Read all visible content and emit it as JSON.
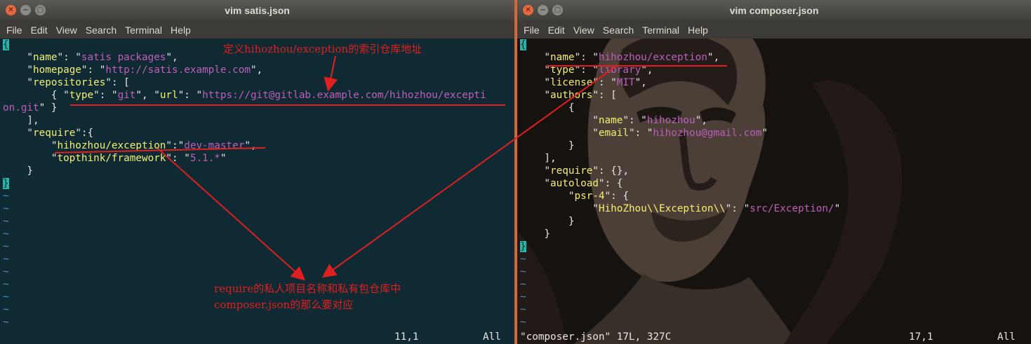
{
  "left_window": {
    "title": "vim satis.json",
    "menu": [
      "File",
      "Edit",
      "View",
      "Search",
      "Terminal",
      "Help"
    ],
    "lines": [
      [
        [
          "cur",
          "{"
        ]
      ],
      [
        [
          "p",
          "    \""
        ],
        [
          "k",
          "name"
        ],
        [
          "p",
          "\": \""
        ],
        [
          "s",
          "satis packages"
        ],
        [
          "p",
          "\","
        ]
      ],
      [
        [
          "p",
          "    \""
        ],
        [
          "k",
          "homepage"
        ],
        [
          "p",
          "\": \""
        ],
        [
          "s",
          "http://satis.example.com"
        ],
        [
          "p",
          "\","
        ]
      ],
      [
        [
          "p",
          "    \""
        ],
        [
          "k",
          "repositories"
        ],
        [
          "p",
          "\": ["
        ]
      ],
      [
        [
          "p",
          "        { \""
        ],
        [
          "k",
          "type"
        ],
        [
          "p",
          "\": \""
        ],
        [
          "s",
          "git"
        ],
        [
          "p",
          "\", \""
        ],
        [
          "k",
          "url"
        ],
        [
          "p",
          "\": \""
        ],
        [
          "s",
          "https://git@gitlab.example.com/hihozhou/excepti"
        ]
      ],
      [
        [
          "s",
          "on.git"
        ],
        [
          "p",
          "\" }"
        ]
      ],
      [
        [
          "p",
          "    ],"
        ]
      ],
      [
        [
          "p",
          "    \""
        ],
        [
          "k",
          "require"
        ],
        [
          "p",
          "\":{"
        ]
      ],
      [
        [
          "p",
          "        \""
        ],
        [
          "k",
          "hihozhou/exception"
        ],
        [
          "p",
          "\":\""
        ],
        [
          "s",
          "dev-master"
        ],
        [
          "p",
          "\","
        ]
      ],
      [
        [
          "p",
          "        \""
        ],
        [
          "k",
          "topthink/framework"
        ],
        [
          "p",
          "\": \""
        ],
        [
          "s",
          "5.1.*"
        ],
        [
          "p",
          "\""
        ]
      ],
      [
        [
          "p",
          "    }"
        ]
      ],
      [
        [
          "cur",
          "}"
        ]
      ],
      [
        [
          "t",
          "~"
        ]
      ],
      [
        [
          "t",
          "~"
        ]
      ],
      [
        [
          "t",
          "~"
        ]
      ],
      [
        [
          "t",
          "~"
        ]
      ],
      [
        [
          "t",
          "~"
        ]
      ],
      [
        [
          "t",
          "~"
        ]
      ],
      [
        [
          "t",
          "~"
        ]
      ],
      [
        [
          "t",
          "~"
        ]
      ],
      [
        [
          "t",
          "~"
        ]
      ],
      [
        [
          "t",
          "~"
        ]
      ],
      [
        [
          "t",
          "~"
        ]
      ]
    ],
    "status_left": "",
    "status_pos": "11,1",
    "status_all": "All"
  },
  "right_window": {
    "title": "vim composer.json",
    "menu": [
      "File",
      "Edit",
      "View",
      "Search",
      "Terminal",
      "Help"
    ],
    "lines": [
      [
        [
          "cur",
          "{"
        ]
      ],
      [
        [
          "p",
          "    \""
        ],
        [
          "k",
          "name"
        ],
        [
          "p",
          "\": \""
        ],
        [
          "s",
          "hihozhou/exception"
        ],
        [
          "p",
          "\","
        ]
      ],
      [
        [
          "p",
          "    \""
        ],
        [
          "k",
          "type"
        ],
        [
          "p",
          "\": \""
        ],
        [
          "s",
          "library"
        ],
        [
          "p",
          "\","
        ]
      ],
      [
        [
          "p",
          "    \""
        ],
        [
          "k",
          "license"
        ],
        [
          "p",
          "\": \""
        ],
        [
          "s",
          "MIT"
        ],
        [
          "p",
          "\","
        ]
      ],
      [
        [
          "p",
          "    \""
        ],
        [
          "k",
          "authors"
        ],
        [
          "p",
          "\": ["
        ]
      ],
      [
        [
          "p",
          "        {"
        ]
      ],
      [
        [
          "p",
          "            \""
        ],
        [
          "k",
          "name"
        ],
        [
          "p",
          "\": \""
        ],
        [
          "s",
          "hihozhou"
        ],
        [
          "p",
          "\","
        ]
      ],
      [
        [
          "p",
          "            \""
        ],
        [
          "k",
          "email"
        ],
        [
          "p",
          "\": \""
        ],
        [
          "s",
          "hihozhou@gmail.com"
        ],
        [
          "p",
          "\""
        ]
      ],
      [
        [
          "p",
          "        }"
        ]
      ],
      [
        [
          "p",
          "    ],"
        ]
      ],
      [
        [
          "p",
          "    \""
        ],
        [
          "k",
          "require"
        ],
        [
          "p",
          "\": {},"
        ]
      ],
      [
        [
          "p",
          "    \""
        ],
        [
          "k",
          "autoload"
        ],
        [
          "p",
          "\": {"
        ]
      ],
      [
        [
          "p",
          "        \""
        ],
        [
          "k",
          "psr-4"
        ],
        [
          "p",
          "\": {"
        ]
      ],
      [
        [
          "p",
          "            \""
        ],
        [
          "k",
          "HihoZhou\\\\Exception\\\\"
        ],
        [
          "p",
          "\": \""
        ],
        [
          "s",
          "src/Exception/"
        ],
        [
          "p",
          "\""
        ]
      ],
      [
        [
          "p",
          "        }"
        ]
      ],
      [
        [
          "p",
          "    }"
        ]
      ],
      [
        [
          "cur",
          "}"
        ]
      ],
      [
        [
          "t",
          "~"
        ]
      ],
      [
        [
          "t",
          "~"
        ]
      ],
      [
        [
          "t",
          "~"
        ]
      ],
      [
        [
          "t",
          "~"
        ]
      ],
      [
        [
          "t",
          "~"
        ]
      ],
      [
        [
          "t",
          "~"
        ]
      ]
    ],
    "status_left": "\"composer.json\" 17L, 327C",
    "status_pos": "17,1",
    "status_all": "All"
  },
  "annotations": {
    "top_note": "定义hihozhou/exception的索引仓库地址",
    "bottom_note_line1": "require的私人项目名称和私有包仓库中",
    "bottom_note_line2": "composer.json的那么要对应",
    "color": "#e02020"
  },
  "colors": {
    "left_bg": "#0f2a33",
    "key": "#f3f071",
    "string": "#bd5fba",
    "tilde": "#5c8cb4",
    "cursor": "#2ab3a8",
    "divider": "#d4683a"
  }
}
